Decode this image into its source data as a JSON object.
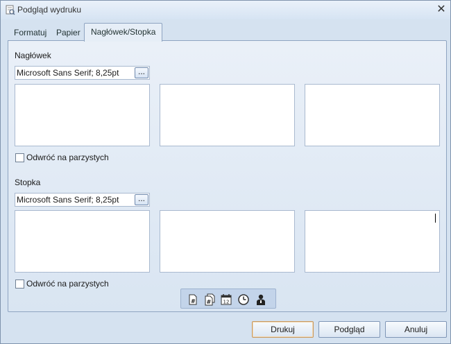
{
  "window": {
    "title": "Podgląd wydruku",
    "close_label": "✕"
  },
  "tabs": [
    {
      "label": "Formatuj",
      "active": false
    },
    {
      "label": "Papier",
      "active": false
    },
    {
      "label": "Nagłówek/Stopka",
      "active": true
    }
  ],
  "header_section": {
    "label": "Nagłówek",
    "font_value": "Microsoft Sans Serif; 8,25pt",
    "font_button_label": "...",
    "textboxes": [
      "",
      "",
      ""
    ],
    "mirror_checkbox": {
      "label": "Odwróć na parzystych",
      "checked": false
    }
  },
  "footer_section": {
    "label": "Stopka",
    "font_value": "Microsoft Sans Serif; 8,25pt",
    "font_button_label": "...",
    "textboxes": [
      "",
      "",
      ""
    ],
    "mirror_checkbox": {
      "label": "Odwróć na parzystych",
      "checked": false
    }
  },
  "insert_toolbar": {
    "icons": [
      "page-number-icon",
      "page-count-icon",
      "date-icon",
      "time-icon",
      "user-icon"
    ]
  },
  "buttons": {
    "print": "Drukuj",
    "preview": "Podgląd",
    "cancel": "Anuluj"
  },
  "colors": {
    "panel_border": "#8ea4c1",
    "default_button_border": "#c79a62"
  }
}
